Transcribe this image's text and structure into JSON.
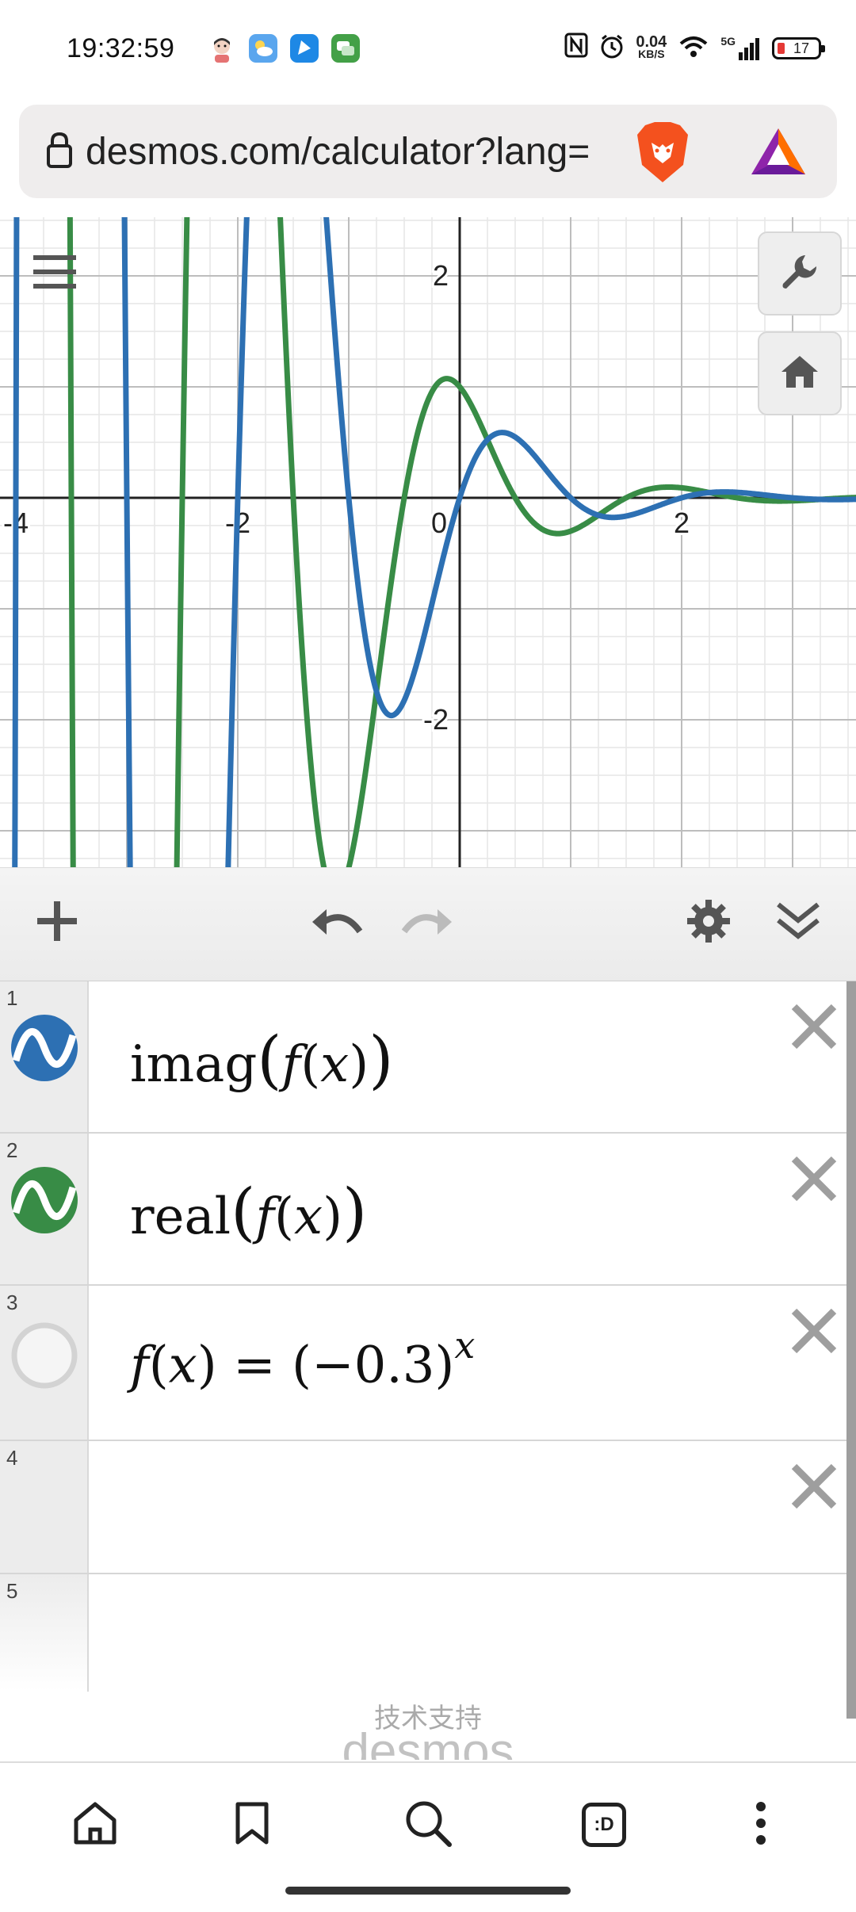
{
  "status_bar": {
    "time": "19:32:59",
    "net_speed_value": "0.04",
    "net_speed_unit": "KB/S",
    "network": "5G",
    "battery": "17"
  },
  "browser": {
    "url": "desmos.com/calculator?lang=",
    "accent_colors": {
      "brave": "#f4511e",
      "bat": "#8e24aa"
    }
  },
  "graph": {
    "x_ticks": [
      "-4",
      "-2",
      "0",
      "2"
    ],
    "y_ticks": [
      "2",
      "-2"
    ],
    "series_colors": {
      "imag": "#2d70b3",
      "real": "#388c46"
    },
    "grid": true
  },
  "toolbar": {
    "add_icon": "plus-icon",
    "undo_icon": "undo-icon",
    "redo_icon": "redo-icon",
    "settings_icon": "gear-icon",
    "collapse_icon": "double-chevron-down-icon"
  },
  "expressions": [
    {
      "num": "1",
      "fn": "imag",
      "arg": "f",
      "var": "x",
      "color": "#2d70b3"
    },
    {
      "num": "2",
      "fn": "real",
      "arg": "f",
      "var": "x",
      "color": "#388c46"
    },
    {
      "num": "3",
      "lhs_fn": "f",
      "lhs_var": "x",
      "equals": "=",
      "base": "−0.3",
      "exponent": "x"
    },
    {
      "num": "4"
    },
    {
      "num": "5"
    }
  ],
  "footer": {
    "powered_by": "技术支持",
    "logo": "desmos"
  },
  "bottom_nav": {
    "items": [
      "home-icon",
      "bookmark-icon",
      "search-icon",
      "tabs-icon",
      "more-icon"
    ],
    "tabs_label": ":D"
  }
}
